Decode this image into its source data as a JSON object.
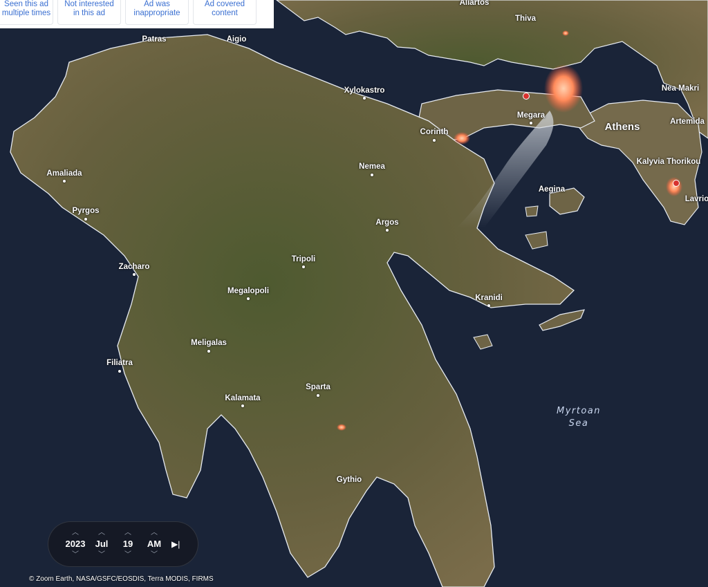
{
  "ad_feedback": {
    "buttons": [
      {
        "label_line1": "Seen this ad",
        "label_line2": "multiple times"
      },
      {
        "label_line1": "Not interested",
        "label_line2": "in this ad"
      },
      {
        "label_line1": "Ad was",
        "label_line2": "inappropriate"
      },
      {
        "label_line1": "Ad covered",
        "label_line2": "content"
      }
    ]
  },
  "map": {
    "places": {
      "aliartos": "Aliartos",
      "thiva": "Thiva",
      "patras": "Patras",
      "aigio": "Aigio",
      "xylokastro": "Xylokastro",
      "nea_makri": "Nea Makri",
      "megara": "Megara",
      "athens": "Athens",
      "artemida": "Artemida",
      "corinth": "Corinth",
      "amaliada": "Amaliada",
      "nemea": "Nemea",
      "kalyvia": "Kalyvia Thorikou",
      "aegina": "Aegina",
      "lavrio": "Lavrio",
      "pyrgos": "Pyrgos",
      "argos": "Argos",
      "tripoli": "Tripoli",
      "zacharo": "Zacharo",
      "megalopoli": "Megalopoli",
      "kranidi": "Kranidi",
      "meligalas": "Meligalas",
      "filiatra": "Filiatra",
      "sparta": "Sparta",
      "kalamata": "Kalamata",
      "gythio": "Gythio"
    },
    "sea_label_line1": "Myrtoan",
    "sea_label_line2": "Sea",
    "colors": {
      "sea": "#1a2438",
      "land": "#5b5a3a",
      "fire": "#ff7a4a",
      "smoke": "#c8cdd4"
    }
  },
  "time_control": {
    "year": "2023",
    "month": "Jul",
    "day": "19",
    "period": "AM",
    "up_icon": "chevron-up-icon",
    "down_icon": "chevron-down-icon",
    "play_icon": "skip-forward-icon"
  },
  "attribution": "© Zoom Earth, NASA/GSFC/EOSDIS, Terra MODIS, FIRMS"
}
